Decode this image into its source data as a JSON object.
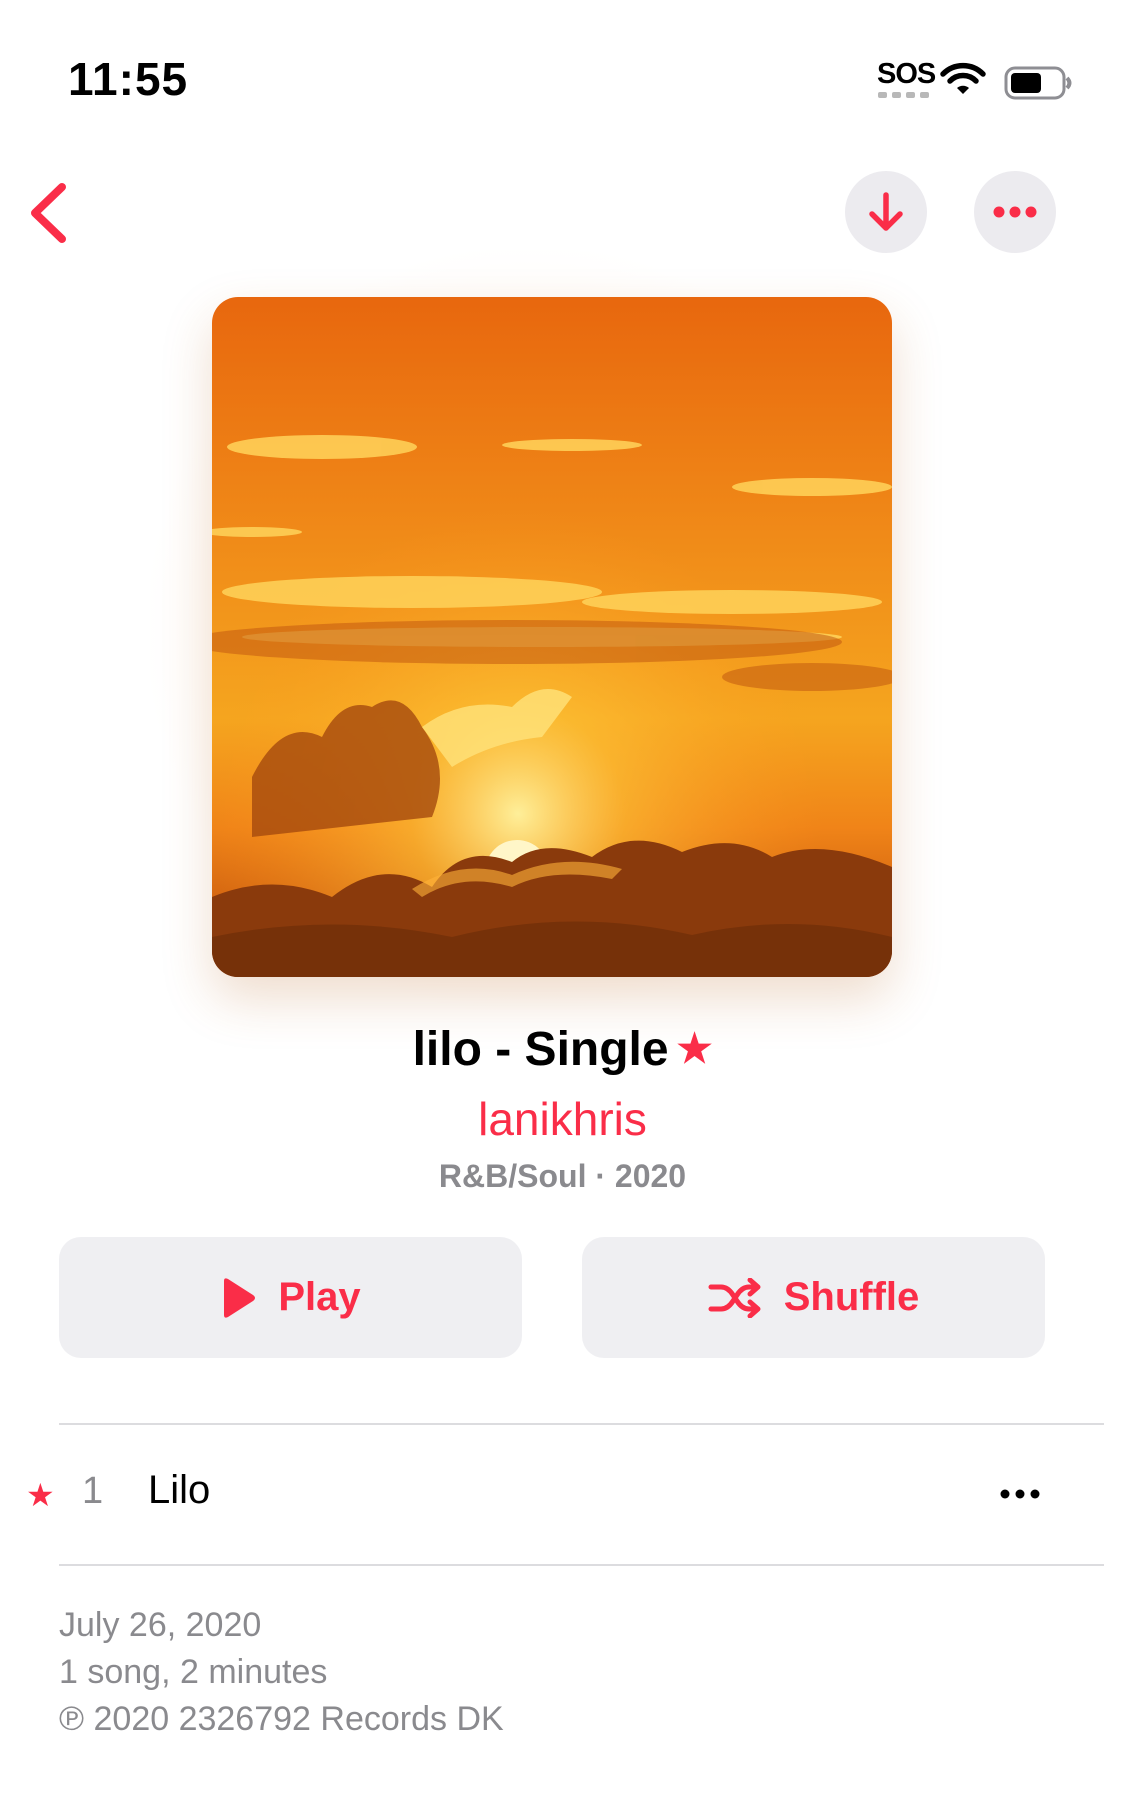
{
  "status_bar": {
    "time": "11:55",
    "sos": "SOS",
    "icons": [
      "wifi-icon",
      "battery-icon"
    ]
  },
  "nav": {
    "back_icon": "chevron-left-icon",
    "download_icon": "arrow-down-icon",
    "more_icon": "ellipsis-icon"
  },
  "album": {
    "title": "lilo - Single",
    "favorite_mark": "★",
    "artist": "lanikhris",
    "meta": "R&B/Soul · 2020",
    "artwork_description_icon": "sunset-artwork"
  },
  "actions": {
    "play_label": "Play",
    "play_icon": "play-icon",
    "shuffle_label": "Shuffle",
    "shuffle_icon": "shuffle-icon"
  },
  "tracks": [
    {
      "favorite_mark": "★",
      "number": "1",
      "title": "Lilo",
      "more_icon": "ellipsis-icon"
    }
  ],
  "footer": {
    "release_date": "July 26, 2020",
    "summary": "1 song, 2 minutes",
    "copyright": "℗ 2020 2326792 Records DK"
  },
  "colors": {
    "accent": "#fa2d48",
    "secondary_text": "#8a8a8e",
    "button_bg": "#efeff2"
  }
}
